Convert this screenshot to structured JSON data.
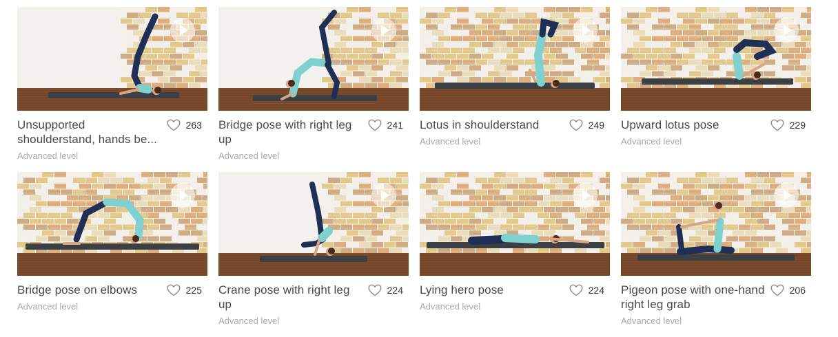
{
  "cards": [
    {
      "title": "Unsupported shoulderstand, hands be...",
      "likes": "263",
      "level": "Advanced level",
      "lines": 2,
      "pose": "shoulderstand",
      "wall": "brick"
    },
    {
      "title": "Bridge pose with right leg up",
      "likes": "241",
      "level": "Advanced level",
      "lines": 2,
      "pose": "bridge-leg",
      "wall": "brick"
    },
    {
      "title": "Lotus in shoulderstand",
      "likes": "249",
      "level": "Advanced level",
      "lines": 1,
      "pose": "lotus-shoulder",
      "wall": "brick"
    },
    {
      "title": "Upward lotus pose",
      "likes": "229",
      "level": "Advanced level",
      "lines": 1,
      "pose": "upward-lotus",
      "wall": "brick"
    },
    {
      "title": "Bridge pose on elbows",
      "likes": "225",
      "level": "Advanced level",
      "lines": 1,
      "pose": "bridge-elbows",
      "wall": "brick"
    },
    {
      "title": "Crane pose with right leg up",
      "likes": "224",
      "level": "Advanced level",
      "lines": 2,
      "pose": "crane-leg",
      "wall": "brick"
    },
    {
      "title": "Lying hero pose",
      "likes": "224",
      "level": "Advanced level",
      "lines": 1,
      "pose": "lying-hero",
      "wall": "brick"
    },
    {
      "title": "Pigeon pose with one-hand right leg grab",
      "likes": "206",
      "level": "Advanced level",
      "lines": 2,
      "pose": "pigeon",
      "wall": "brick"
    }
  ],
  "colors": {
    "wall_white": "#f2f1ee",
    "brick_a": "#e2c27a",
    "brick_b": "#d9a36a",
    "brick_c": "#f4efe6",
    "floor": "#7a4a2c",
    "mat": "#3c3f44",
    "top": "#7fd1cf",
    "pants": "#1f2f55",
    "skin": "#d8a585",
    "hair": "#4a2b1e"
  }
}
